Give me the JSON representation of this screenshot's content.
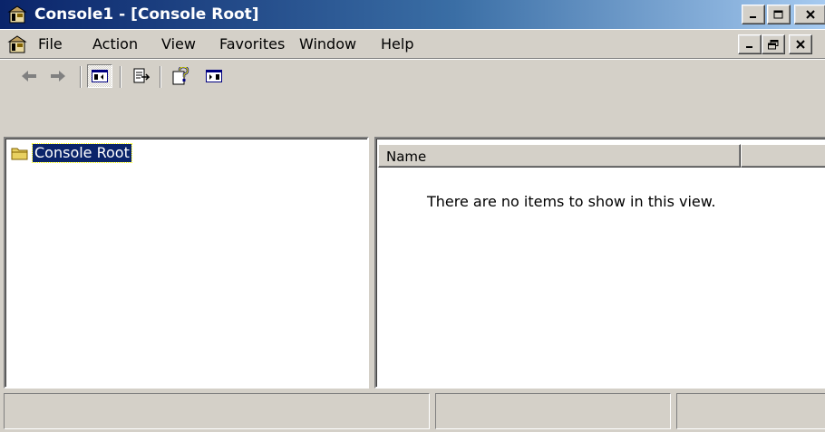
{
  "window": {
    "title": "Console1 - [Console Root]"
  },
  "menu": {
    "items": [
      {
        "label": "File"
      },
      {
        "label": "Action"
      },
      {
        "label": "View"
      },
      {
        "label": "Favorites"
      },
      {
        "label": "Window"
      },
      {
        "label": "Help"
      }
    ]
  },
  "toolbar": {
    "buttons": [
      "back-arrow-icon",
      "forward-arrow-icon",
      "show-hide-tree-icon",
      "export-list-icon",
      "help-icon",
      "show-hide-action-pane-icon"
    ]
  },
  "tree": {
    "root_label": "Console Root"
  },
  "list": {
    "columns": [
      "Name",
      ""
    ],
    "empty_message": "There are no items to show in this view."
  },
  "colors": {
    "title_start": "#0a246a",
    "title_end": "#a6caf0",
    "face": "#d4d0c8",
    "selection": "#0a246a"
  }
}
